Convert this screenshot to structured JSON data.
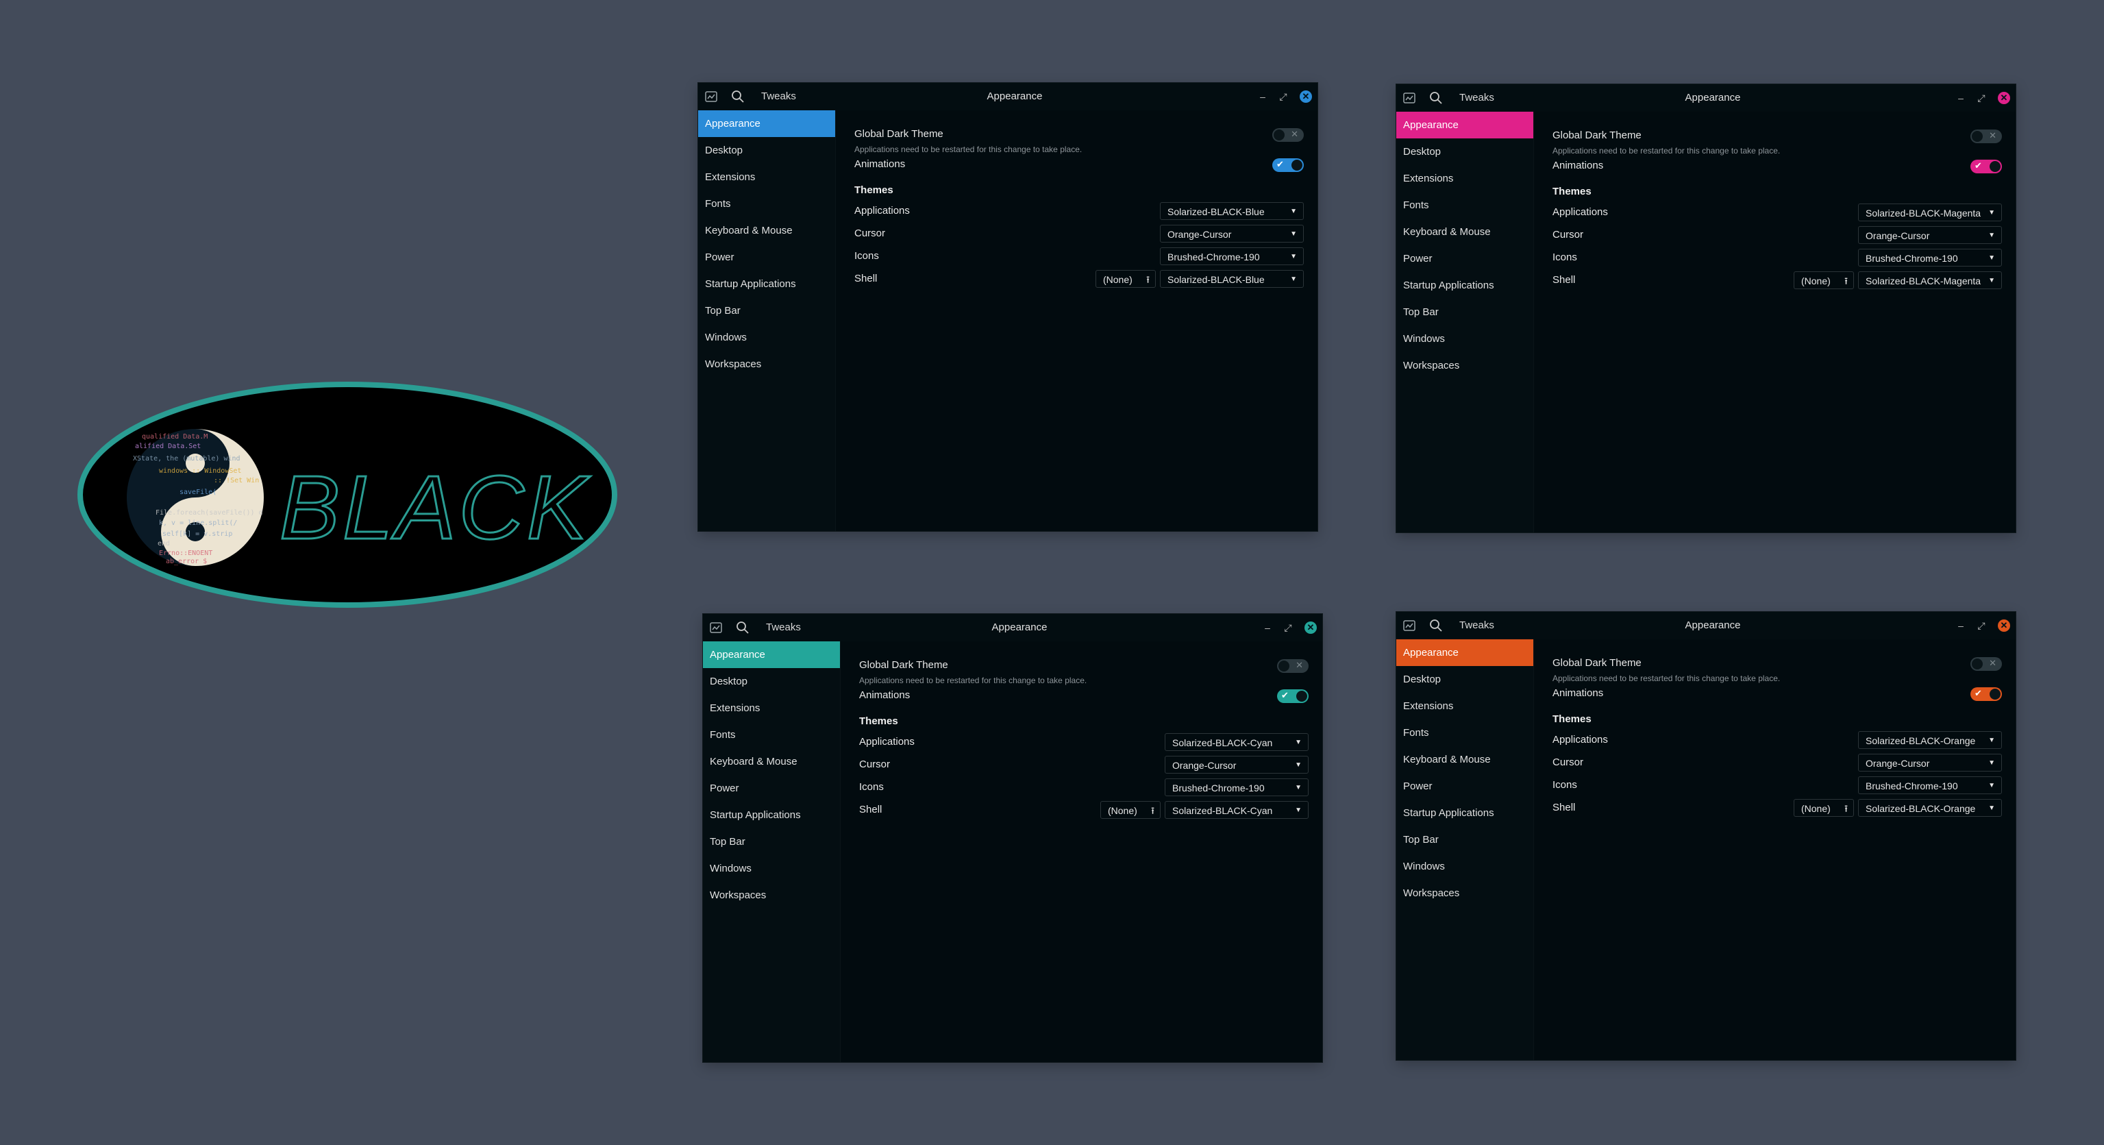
{
  "logo": {
    "text": "BLACK",
    "code_lines": [
      "qualified Data.M",
      "alified Data.Set",
      "XState, the (mutable) wind",
      "windows :: WindowSet",
      "   :: !Set Win",
      "saveFile(",
      "File.foreach(saveFile()) d",
      "k, v = line.split(/",
      "self[k] = v.strip",
      "end",
      "Errno::ENOENT",
      "ab_error $"
    ]
  },
  "windows": [
    {
      "accent": "#2a8bd8",
      "app_name": "Tweaks",
      "title": "Appearance",
      "sidebar": [
        "Appearance",
        "Desktop",
        "Extensions",
        "Fonts",
        "Keyboard & Mouse",
        "Power",
        "Startup Applications",
        "Top Bar",
        "Windows",
        "Workspaces"
      ],
      "global_dark_theme": {
        "label": "Global Dark Theme",
        "note": "Applications need to be restarted for this change to take place.",
        "state": "off"
      },
      "animations": {
        "label": "Animations",
        "state": "on"
      },
      "themes_heading": "Themes",
      "themes": {
        "applications": {
          "label": "Applications",
          "value": "Solarized-BLACK-Blue"
        },
        "cursor": {
          "label": "Cursor",
          "value": "Orange-Cursor"
        },
        "icons": {
          "label": "Icons",
          "value": "Brushed-Chrome-190"
        },
        "shell": {
          "label": "Shell",
          "button": "(None)",
          "value": "Solarized-BLACK-Blue"
        }
      }
    },
    {
      "accent": "#e0218a",
      "app_name": "Tweaks",
      "title": "Appearance",
      "sidebar": [
        "Appearance",
        "Desktop",
        "Extensions",
        "Fonts",
        "Keyboard & Mouse",
        "Power",
        "Startup Applications",
        "Top Bar",
        "Windows",
        "Workspaces"
      ],
      "global_dark_theme": {
        "label": "Global Dark Theme",
        "note": "Applications need to be restarted for this change to take place.",
        "state": "off"
      },
      "animations": {
        "label": "Animations",
        "state": "on"
      },
      "themes_heading": "Themes",
      "themes": {
        "applications": {
          "label": "Applications",
          "value": "Solarized-BLACK-Magenta"
        },
        "cursor": {
          "label": "Cursor",
          "value": "Orange-Cursor"
        },
        "icons": {
          "label": "Icons",
          "value": "Brushed-Chrome-190"
        },
        "shell": {
          "label": "Shell",
          "button": "(None)",
          "value": "Solarized-BLACK-Magenta"
        }
      }
    },
    {
      "accent": "#23a69a",
      "app_name": "Tweaks",
      "title": "Appearance",
      "sidebar": [
        "Appearance",
        "Desktop",
        "Extensions",
        "Fonts",
        "Keyboard & Mouse",
        "Power",
        "Startup Applications",
        "Top Bar",
        "Windows",
        "Workspaces"
      ],
      "global_dark_theme": {
        "label": "Global Dark Theme",
        "note": "Applications need to be restarted for this change to take place.",
        "state": "off"
      },
      "animations": {
        "label": "Animations",
        "state": "on"
      },
      "themes_heading": "Themes",
      "themes": {
        "applications": {
          "label": "Applications",
          "value": "Solarized-BLACK-Cyan"
        },
        "cursor": {
          "label": "Cursor",
          "value": "Orange-Cursor"
        },
        "icons": {
          "label": "Icons",
          "value": "Brushed-Chrome-190"
        },
        "shell": {
          "label": "Shell",
          "button": "(None)",
          "value": "Solarized-BLACK-Cyan"
        }
      }
    },
    {
      "accent": "#e0551c",
      "app_name": "Tweaks",
      "title": "Appearance",
      "sidebar": [
        "Appearance",
        "Desktop",
        "Extensions",
        "Fonts",
        "Keyboard & Mouse",
        "Power",
        "Startup Applications",
        "Top Bar",
        "Windows",
        "Workspaces"
      ],
      "global_dark_theme": {
        "label": "Global Dark Theme",
        "note": "Applications need to be restarted for this change to take place.",
        "state": "off"
      },
      "animations": {
        "label": "Animations",
        "state": "on"
      },
      "themes_heading": "Themes",
      "themes": {
        "applications": {
          "label": "Applications",
          "value": "Solarized-BLACK-Orange"
        },
        "cursor": {
          "label": "Cursor",
          "value": "Orange-Cursor"
        },
        "icons": {
          "label": "Icons",
          "value": "Brushed-Chrome-190"
        },
        "shell": {
          "label": "Shell",
          "button": "(None)",
          "value": "Solarized-BLACK-Orange"
        }
      }
    }
  ]
}
